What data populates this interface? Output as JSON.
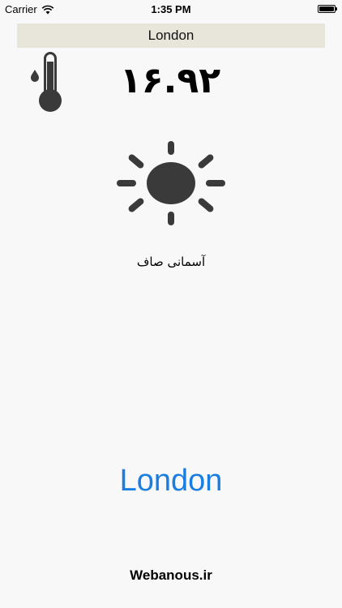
{
  "status_bar": {
    "carrier": "Carrier",
    "time": "1:35 PM",
    "wifi_icon": "wifi-icon",
    "battery_icon": "battery-icon"
  },
  "header": {
    "city": "London"
  },
  "weather": {
    "thermometer_icon": "thermometer-icon",
    "temperature": "۱۶.۹۲",
    "condition_icon": "sun-icon",
    "condition": "آسمانی صاف"
  },
  "city_button": {
    "label": "London",
    "color": "#1a7ee0"
  },
  "footer": {
    "brand": "Webanous.ir"
  },
  "colors": {
    "background": "#f8f8f8",
    "city_bar_bg": "#e8e5da",
    "icon_dark": "#3a3a3a"
  }
}
